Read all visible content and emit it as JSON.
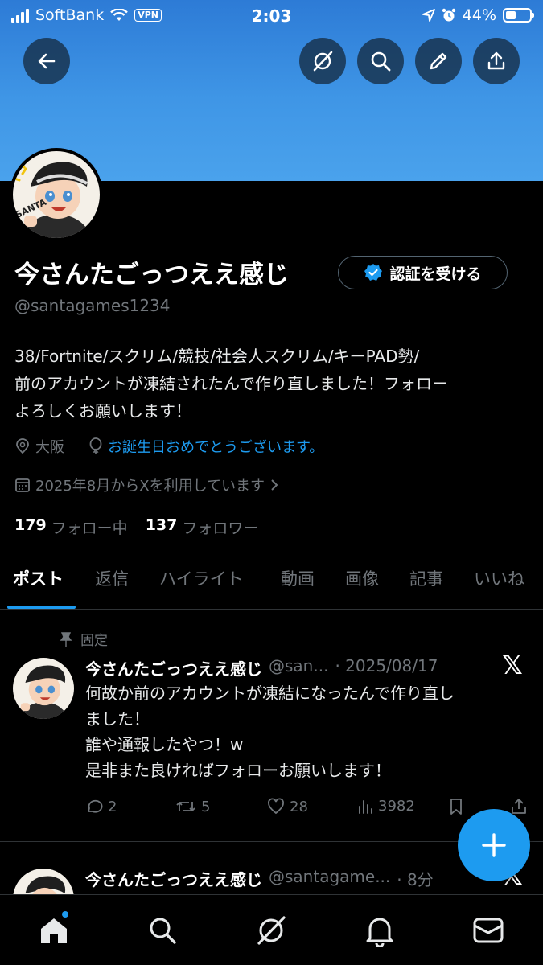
{
  "status_bar": {
    "carrier": "SoftBank",
    "vpn": "VPN",
    "time": "2:03",
    "battery": "44%",
    "battery_level": 0.44
  },
  "profile": {
    "name": "今さんたごっつええ感じ",
    "verify_label": "認証を受ける",
    "handle": "@santagames1234",
    "bio_lines": [
      "38/Fortnite/スクリム/競技/社会人スクリム/キーPAD勢/",
      "前のアカウントが凍結されたんで作り直しました！フォロー",
      "よろしくお願いします！"
    ],
    "location": "大阪",
    "birthday": "お誕生日おめでとうございます。",
    "joined": "2025年8月からXを利用しています",
    "following_count": "179",
    "following_label": "フォロー中",
    "followers_count": "137",
    "followers_label": "フォロワー",
    "avatar_text": "SANTA"
  },
  "tabs": [
    "ポスト",
    "返信",
    "ハイライト",
    "動画",
    "画像",
    "記事",
    "いいね"
  ],
  "posts": [
    {
      "pinned_label": "固定",
      "name": "今さんたごっつええ感じ",
      "handle": "@san...",
      "date": "· 2025/08/17",
      "lines": [
        "何故か前のアカウントが凍結になったんで作り直し",
        "ました！",
        "誰や通報したやつ！w",
        "是非また良ければフォローお願いします！"
      ],
      "replies": "2",
      "reposts": "5",
      "likes": "28",
      "views": "3982"
    },
    {
      "name": "今さんたごっつええ感じ",
      "handle": "@santagame...",
      "date": "· 8分"
    }
  ],
  "colors": {
    "accent": "#1d9bf0",
    "banner": "#3f96e6",
    "background": "#000000",
    "muted": "#71767b"
  },
  "icons": {
    "x_logo": "𝕏"
  }
}
